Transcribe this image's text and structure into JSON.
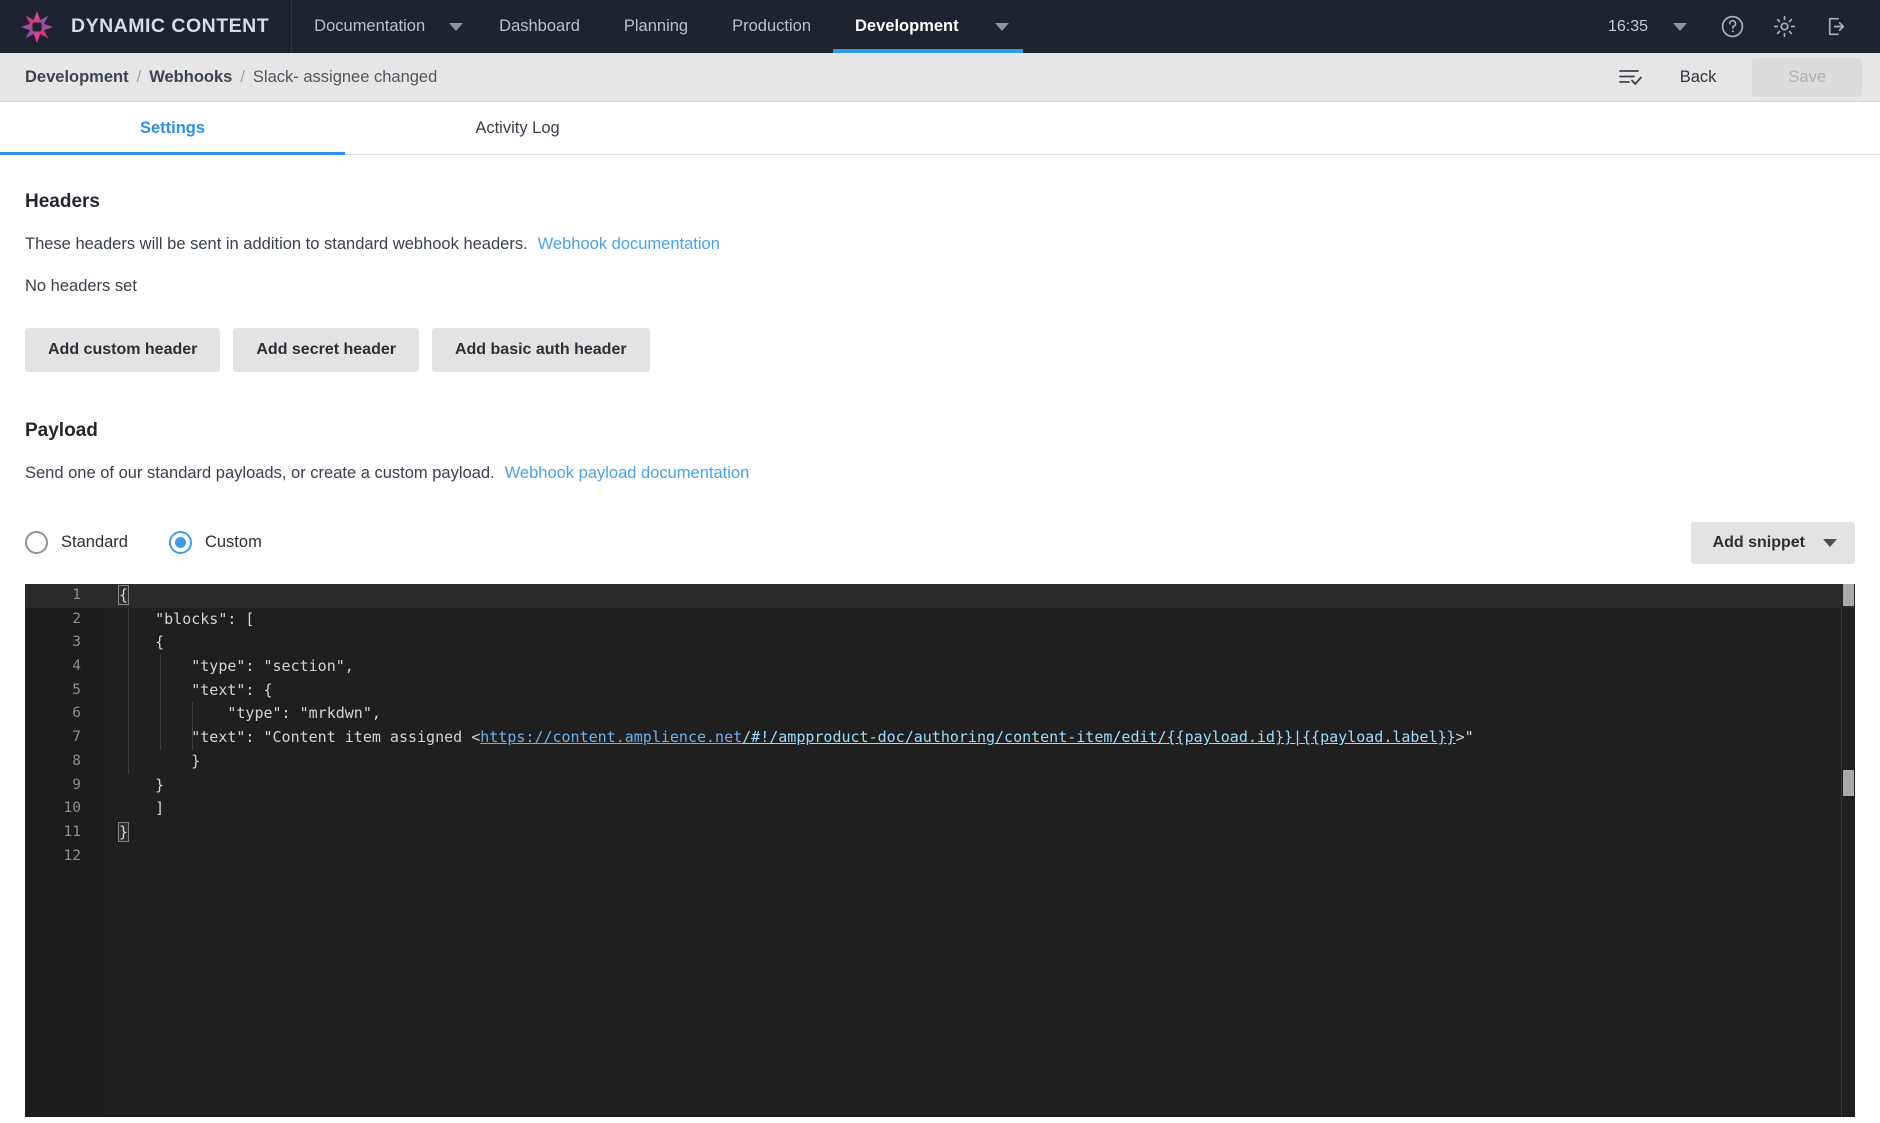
{
  "topnav": {
    "brand": "DYNAMIC CONTENT",
    "logo_icon": "amplience-starburst-logo",
    "items": [
      {
        "label": "Documentation",
        "has_caret": true,
        "active": false
      },
      {
        "label": "Dashboard",
        "has_caret": false,
        "active": false
      },
      {
        "label": "Planning",
        "has_caret": false,
        "active": false
      },
      {
        "label": "Production",
        "has_caret": false,
        "active": false
      },
      {
        "label": "Development",
        "has_caret": true,
        "active": true
      }
    ],
    "clock": "16:35",
    "icons": {
      "clock_caret": "chevron-down-icon",
      "help": "help-circle-icon",
      "settings": "gear-icon",
      "logout": "logout-icon"
    }
  },
  "breadcrumb": {
    "root": "Development",
    "sep": "/",
    "parent": "Webhooks",
    "current": "Slack- assignee changed",
    "list_check_icon": "list-check-icon",
    "back_label": "Back",
    "save_label": "Save",
    "save_disabled": true
  },
  "tabs": [
    {
      "label": "Settings",
      "active": true
    },
    {
      "label": "Activity Log",
      "active": false
    }
  ],
  "headers_section": {
    "title": "Headers",
    "description": "These headers will be sent in addition to standard webhook headers.",
    "doc_link": "Webhook documentation",
    "empty_state": "No headers set",
    "buttons": [
      "Add custom header",
      "Add secret header",
      "Add basic auth header"
    ]
  },
  "payload_section": {
    "title": "Payload",
    "description": "Send one of our standard payloads, or create a custom payload.",
    "doc_link": "Webhook payload documentation",
    "radios": [
      {
        "label": "Standard",
        "selected": false
      },
      {
        "label": "Custom",
        "selected": true
      }
    ],
    "snippet_button": "Add snippet",
    "snippet_caret_icon": "chevron-down-icon"
  },
  "editor": {
    "language": "json",
    "line_numbers": [
      1,
      2,
      3,
      4,
      5,
      6,
      7,
      8,
      9,
      10,
      11,
      12
    ],
    "lines": [
      "{",
      "    \"blocks\": [",
      "    {",
      "        \"type\": \"section\",",
      "        \"text\": {",
      "            \"type\": \"mrkdwn\",",
      "            \"text\": \"Content item assigned <https://content.amplience.net/#!/ampproduct-doc/authoring/content-item/edit/{{payload.id}}|{{payload.label}}>\"",
      "        }",
      "    }",
      "    ]",
      "}",
      ""
    ],
    "line7_parts": {
      "prefix": "        \"text\": \"Content item assigned <",
      "url_scheme": "https://content.amplience.net",
      "url_path": "/#!/ampproduct-doc/authoring/content-item/edit/",
      "token_id": "{{payload.id}}",
      "pipe": "|",
      "token_label": "{{payload.label}}",
      "suffix": ">\""
    },
    "colors": {
      "background": "#1f1f1f",
      "gutter": "#1c1c1c",
      "text": "#d4d4d4",
      "line_number": "#8e8e8e",
      "link": "#6db2f0",
      "token": "#9cdcfe"
    }
  },
  "theme": {
    "nav_background": "#1d2430",
    "accent_blue": "#2f8fe0",
    "link_blue": "#4aa3e8",
    "crumb_background": "#e6e6e6",
    "button_gray": "#e3e3e3"
  }
}
